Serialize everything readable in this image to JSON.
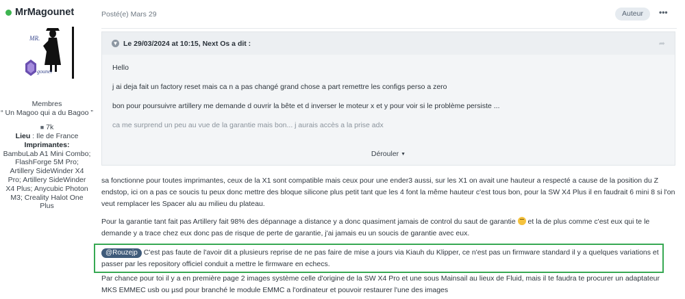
{
  "author": {
    "name": "MrMagounet",
    "group": "Membres",
    "title": "“ Un Magoo qui a du Bagoo ”",
    "post_count": "7k",
    "lieu_label": "Lieu",
    "lieu_value": " : Ile de France",
    "printers_label": "Imprimantes:",
    "printers": "BambuLab A1 Mini Combo; FlashForge 5M Pro; Artillery SideWinder X4 Pro; Artillery SideWinder X4 Plus; Anycubic Photon M3; Creality Halot One Plus",
    "avatar_text_top": "MR.",
    "avatar_text_bottom": "gounet"
  },
  "post": {
    "date": "Posté(e) Mars 29",
    "author_badge": "Auteur",
    "more_icon": "ellipsis-icon"
  },
  "quote": {
    "header": "Le 29/03/2024 at 10:15, Next Os a dit :",
    "lines": [
      "Hello",
      "j ai deja fait un factory reset mais ca n a pas changé grand chose a part remettre les configs perso a zero",
      "bon pour poursuivre artillery me demande d ouvrir la bête et d inverser le moteur x et y pour voir si le problème persiste ...",
      "ca me surprend un peu au vue de la garantie mais bon... j aurais accès a la prise adx"
    ],
    "expand_label": "Dérouler"
  },
  "body": {
    "p1": "sa fonctionne pour toutes imprimantes, ceux de la X1 sont compatible mais ceux pour une ender3 aussi, sur les X1 on avait une hauteur a respecté a cause de la position du Z endstop, ici on a pas ce soucis tu peux donc mettre des bloque silicone plus petit tant que les 4 font la même hauteur c'est tous bon, pour la SW X4 Plus il en faudrait 6 mini 8 si l'on veut remplacer les Spacer alu au milieu du plateau.",
    "p2a": "Pour la garantie tant fait pas Artillery fait 98% des dépannage a distance y a donc quasiment jamais de control du saut de garantie ",
    "p2b": " et la de plus comme c'est eux qui te le demande y a trace chez eux donc pas de risque de perte de garantie, j'ai jamais eu un soucis de garantie avec eux.",
    "mention": "@Rouzejp",
    "p3": " C'est pas faute de l'avoir dit a plusieurs reprise de ne pas faire de mise a jours via Kiauh du Klipper, ce n'est pas un firmware standard il y a quelques variations et passer par les repository officiel conduit a mettre le firmware en echecs.",
    "p4": "Par chance pour toi il y a en première page 2 images système celle d'origine de la SW X4 Pro et une sous Mainsail au lieux de Fluid, mais il te faudra te procurer un adaptateur MKS EMMEC usb ou µsd pour branché le module EMMC a l'ordinateur et pouvoir restaurer l'une des images"
  },
  "colors": {
    "online": "#3db550",
    "highlight_border": "#36a852",
    "mention_bg": "#3f5b7a"
  }
}
